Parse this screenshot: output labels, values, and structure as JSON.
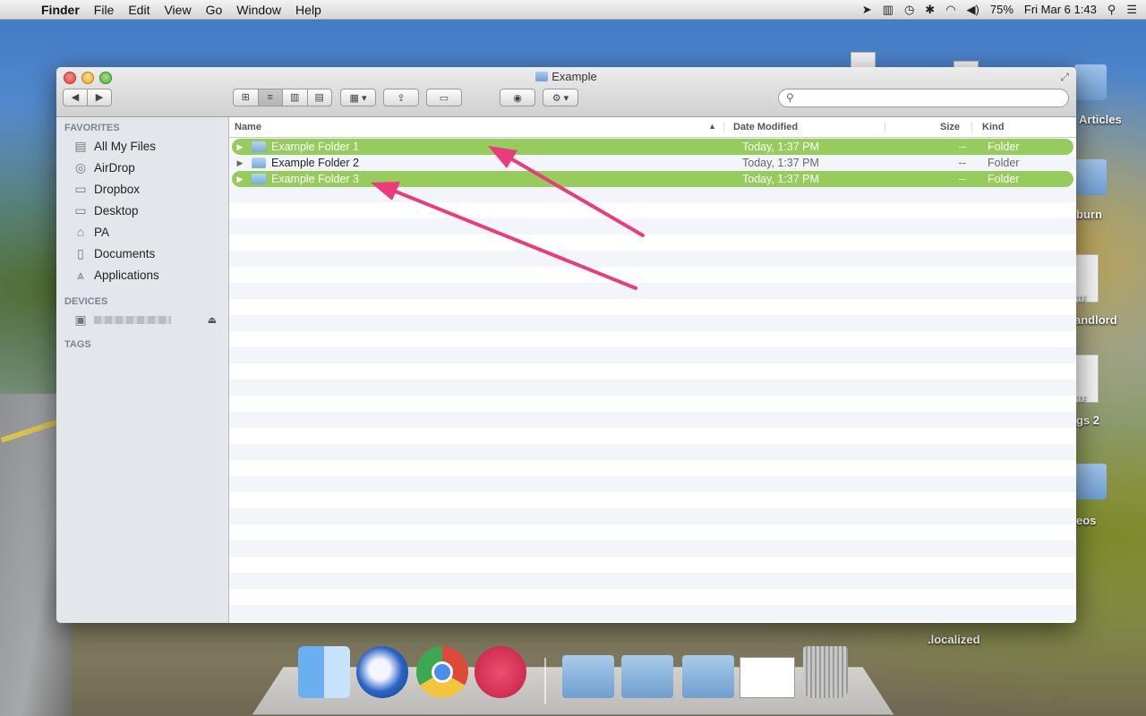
{
  "menubar": {
    "app": "Finder",
    "menus": [
      "File",
      "Edit",
      "View",
      "Go",
      "Window",
      "Help"
    ],
    "battery": "75%",
    "clock": "Fri Mar 6  1:43",
    "status_icons": [
      "skitch-icon",
      "sync-icon",
      "time-machine-icon",
      "bluetooth-icon",
      "wifi-icon",
      "volume-icon",
      "battery-icon",
      "search-icon",
      "notification-center-icon"
    ]
  },
  "desktop": {
    "labels": [
      "Articles",
      "burn",
      "andlord",
      "gs 2",
      "eos",
      ".localized"
    ],
    "doc_tags": [
      "TF",
      "TF"
    ]
  },
  "window": {
    "title": "Example",
    "search_placeholder": ""
  },
  "sidebar": {
    "favorites_header": "FAVORITES",
    "favorites": [
      {
        "label": "All My Files",
        "icon": "all-files-icon"
      },
      {
        "label": "AirDrop",
        "icon": "airdrop-icon"
      },
      {
        "label": "Dropbox",
        "icon": "folder-icon"
      },
      {
        "label": "Desktop",
        "icon": "folder-icon"
      },
      {
        "label": "PA",
        "icon": "home-icon"
      },
      {
        "label": "Documents",
        "icon": "documents-icon"
      },
      {
        "label": "Applications",
        "icon": "applications-icon"
      }
    ],
    "devices_header": "DEVICES",
    "tags_header": "TAGS"
  },
  "list": {
    "columns": {
      "name": "Name",
      "date": "Date Modified",
      "size": "Size",
      "kind": "Kind"
    },
    "rows": [
      {
        "name": "Example Folder 1",
        "date": "Today, 1:37 PM",
        "size": "--",
        "kind": "Folder",
        "selected": true
      },
      {
        "name": "Example Folder 2",
        "date": "Today, 1:37 PM",
        "size": "--",
        "kind": "Folder",
        "selected": false
      },
      {
        "name": "Example Folder 3",
        "date": "Today, 1:37 PM",
        "size": "--",
        "kind": "Folder",
        "selected": true
      }
    ]
  },
  "colors": {
    "selection": "#96cc5c",
    "annotation_arrow": "#ec3b7a"
  },
  "dock": [
    "finder-icon",
    "thunderbird-icon",
    "chrome-icon",
    "skitch-icon",
    "applications-folder-icon",
    "documents-folder-icon",
    "folder-icon",
    "screenshot-icon",
    "trash-icon"
  ]
}
